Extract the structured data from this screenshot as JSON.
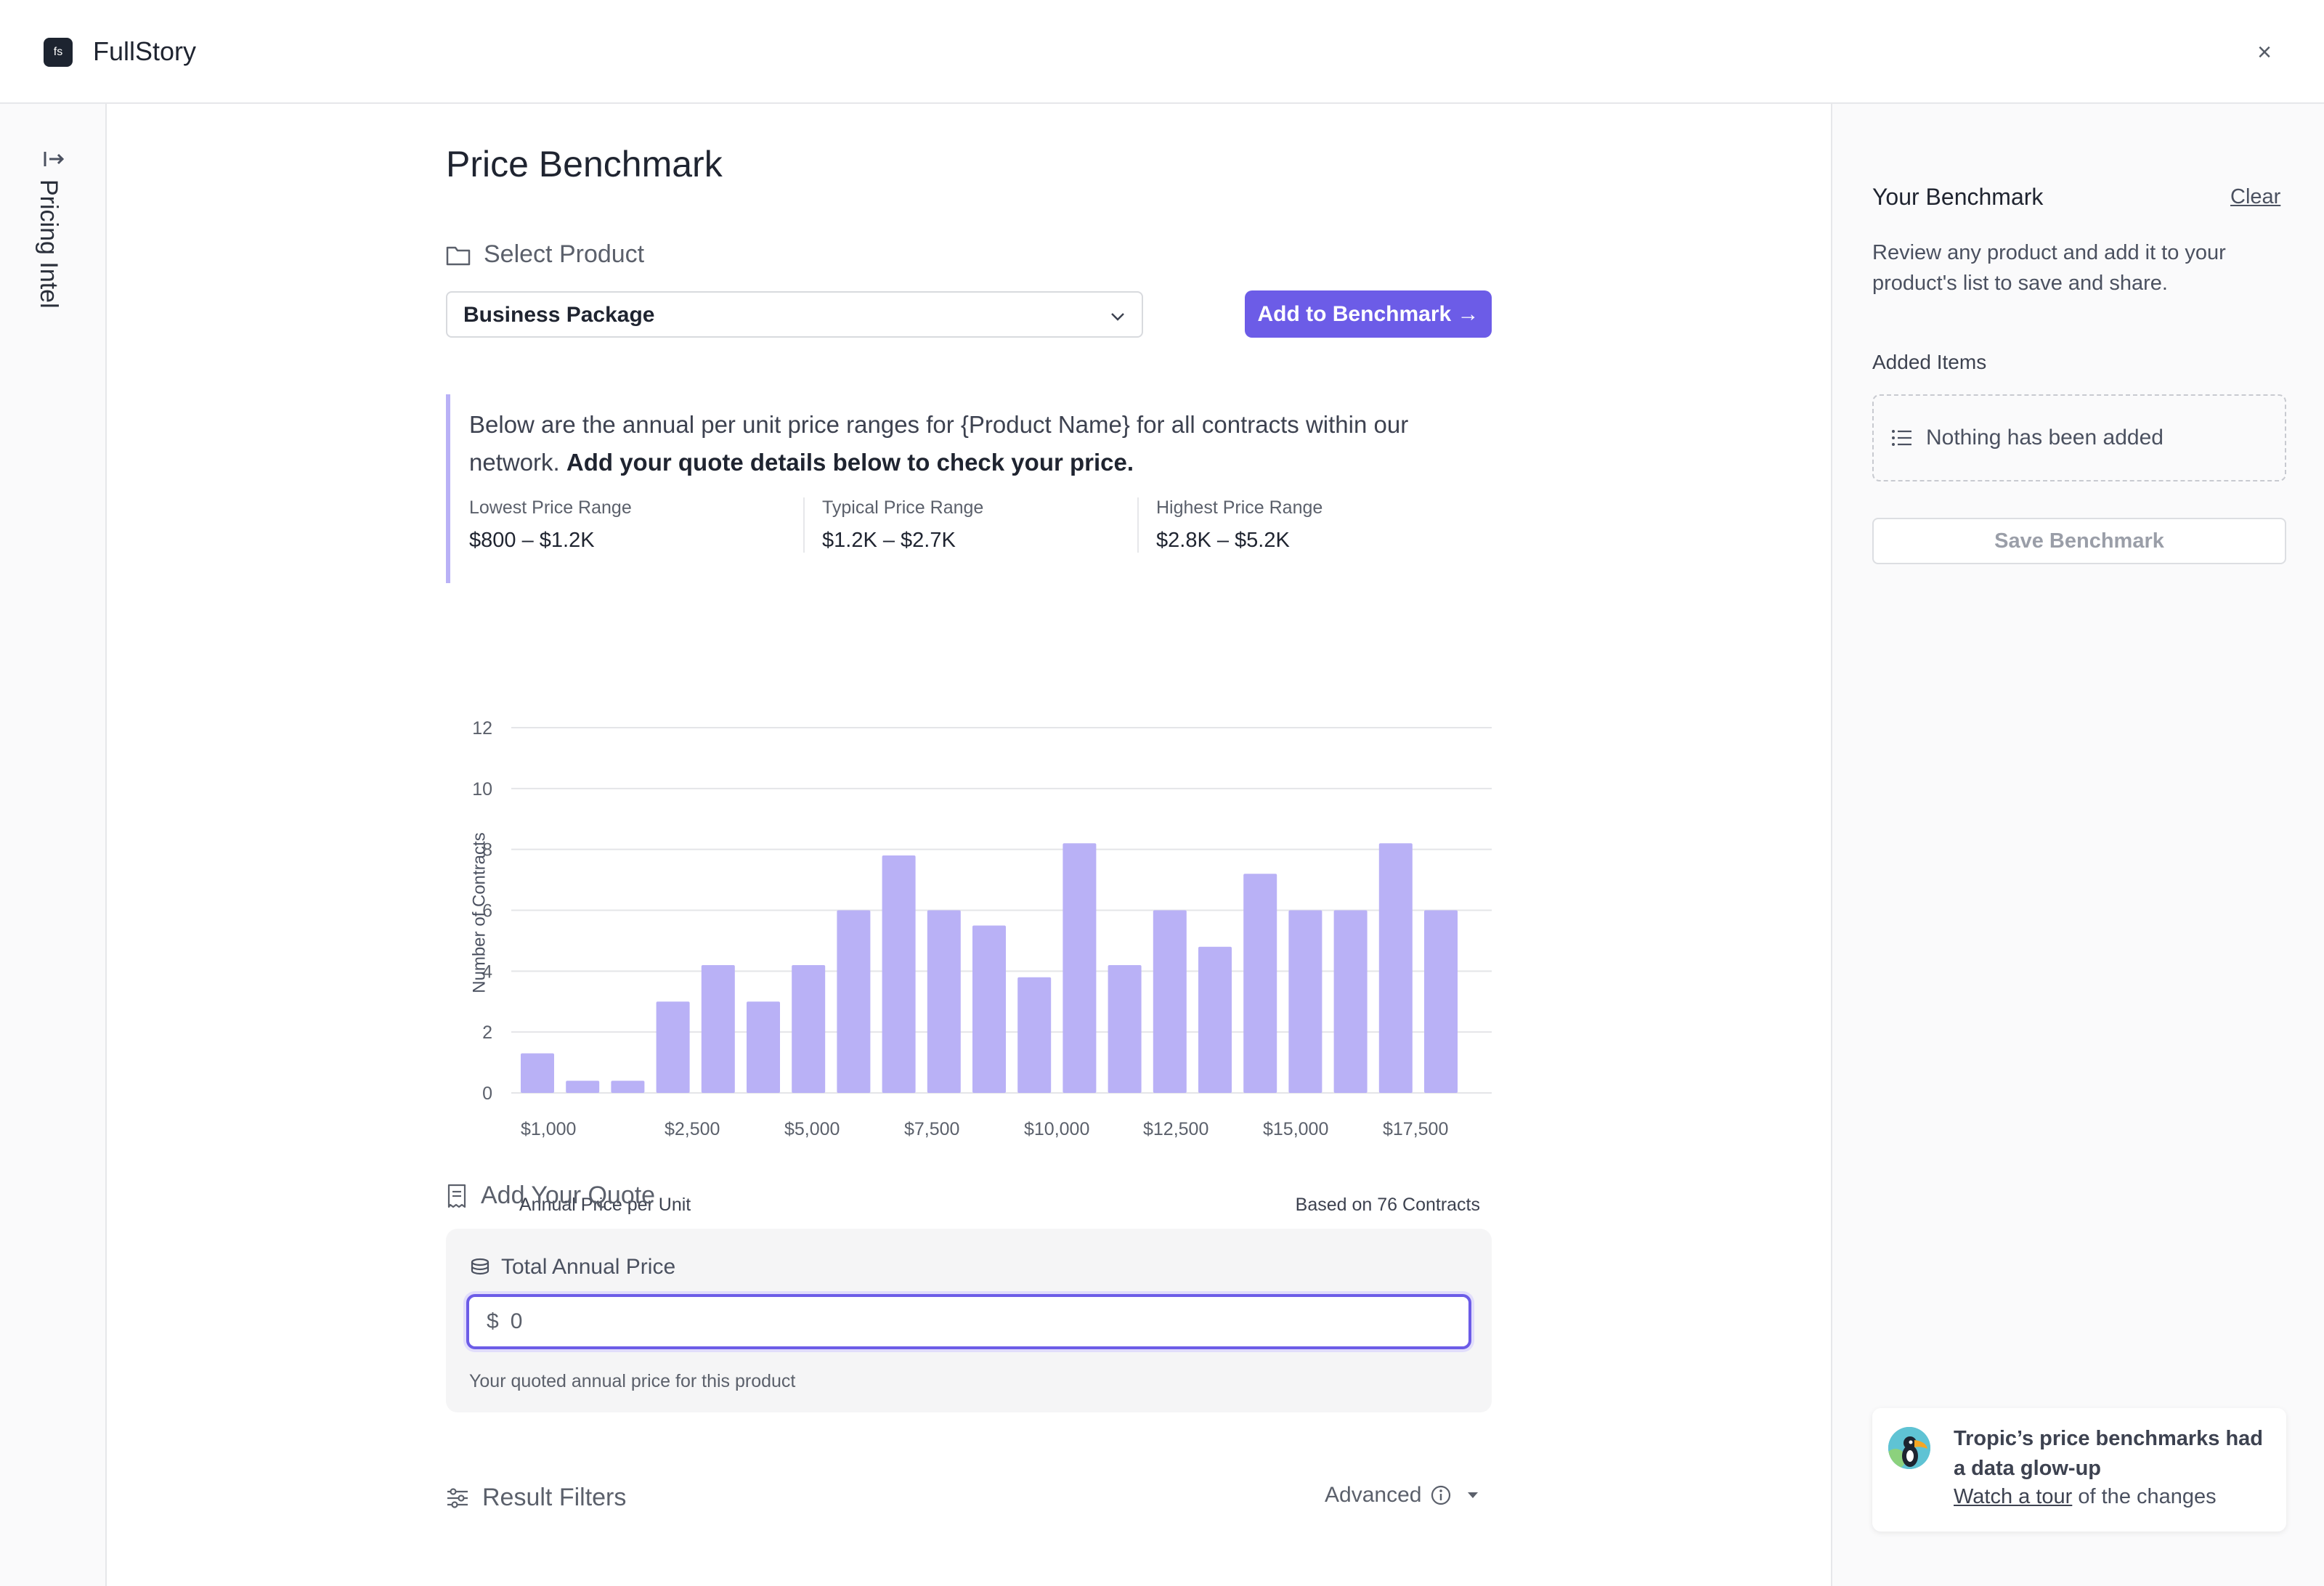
{
  "app": {
    "logo_text": "fs",
    "title": "FullStory",
    "close_glyph": "×"
  },
  "rail": {
    "icon": "panel-expand-icon",
    "label": "Pricing Intel"
  },
  "page": {
    "title": "Price Benchmark",
    "select_product": {
      "heading": "Select Product",
      "icon": "folder-icon",
      "value": "Business Package"
    },
    "add_button": "Add to Benchmark →",
    "intro": {
      "text": "Below are the annual per unit price ranges for {Product Name} for all contracts within our network.",
      "emphasis": "Add your quote details below to check your price."
    },
    "ranges": [
      {
        "label": "Lowest Price Range",
        "value": "$800 – $1.2K"
      },
      {
        "label": "Typical Price Range",
        "value": "$1.2K – $2.7K"
      },
      {
        "label": "Highest Price Range",
        "value": "$2.8K – $5.2K"
      }
    ],
    "quote": {
      "heading": "Add Your Quote",
      "field_label": "Total Annual Price",
      "currency": "$",
      "value": "0",
      "help": "Your quoted annual price for this product"
    },
    "filters": {
      "heading": "Result Filters",
      "advanced_label": "Advanced"
    }
  },
  "chart_data": {
    "type": "bar",
    "ylabel": "Number of Contracts",
    "xlabel": "Annual Price per Unit",
    "note": "Based on 76 Contracts",
    "ylim": [
      0,
      12
    ],
    "yticks": [
      0,
      2,
      4,
      6,
      8,
      10,
      12
    ],
    "xtick_labels": [
      "$1,000",
      "$2,500",
      "$5,000",
      "$7,500",
      "$10,000",
      "$12,500",
      "$15,000",
      "$17,500"
    ],
    "values": [
      1.3,
      0.4,
      0.4,
      3,
      4.2,
      3,
      4.2,
      6,
      7.8,
      6,
      5.5,
      3.8,
      8.2,
      4.2,
      6,
      4.8,
      7.2,
      6,
      6,
      8.2,
      6
    ],
    "bar_color": "#b9b1f6",
    "grid": true
  },
  "sidebar": {
    "title": "Your Benchmark",
    "clear": "Clear",
    "description": "Review any product and add it to your product's list to save and share.",
    "added_heading": "Added Items",
    "empty_text": "Nothing has been added",
    "save_button": "Save Benchmark"
  },
  "promo": {
    "title": "Tropic’s price benchmarks had a data glow-up",
    "link": "Watch a tour",
    "suffix": " of the changes"
  },
  "colors": {
    "accent": "#6c5ce7",
    "bar": "#b9b1f6",
    "info_border": "#b9b1f6"
  }
}
